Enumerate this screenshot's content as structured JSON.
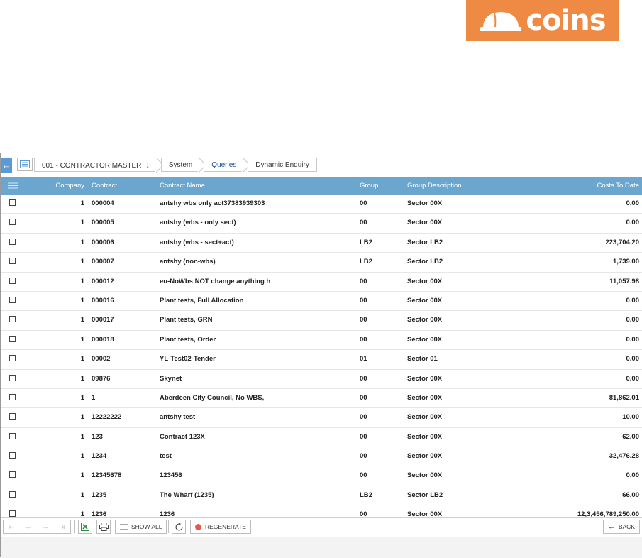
{
  "brand": {
    "name": "coins",
    "color": "#ef8a45"
  },
  "breadcrumb": [
    {
      "label": "001 - CONTRACTOR MASTER",
      "arrow": "↓"
    },
    {
      "label": "System"
    },
    {
      "label": "Queries"
    },
    {
      "label": "Dynamic Enquiry"
    }
  ],
  "table": {
    "headers": [
      "Company",
      "Contract",
      "Contract Name",
      "Group",
      "Group Description",
      "Costs To Date"
    ],
    "rows": [
      {
        "company": "1",
        "contract": "000004",
        "name": "antshy wbs only act37383939303",
        "group": "00",
        "desc": "Sector 00X",
        "cost": "0.00"
      },
      {
        "company": "1",
        "contract": "000005",
        "name": "antshy (wbs - only sect)",
        "group": "00",
        "desc": "Sector 00X",
        "cost": "0.00"
      },
      {
        "company": "1",
        "contract": "000006",
        "name": "antshy (wbs - sect+act)",
        "group": "LB2",
        "desc": "Sector LB2",
        "cost": "223,704.20"
      },
      {
        "company": "1",
        "contract": "000007",
        "name": "antshy (non-wbs)",
        "group": "LB2",
        "desc": "Sector LB2",
        "cost": "1,739.00"
      },
      {
        "company": "1",
        "contract": "000012",
        "name": "eu-NoWbs NOT change anything h",
        "group": "00",
        "desc": "Sector 00X",
        "cost": "11,057.98"
      },
      {
        "company": "1",
        "contract": "000016",
        "name": "Plant tests, Full Allocation",
        "group": "00",
        "desc": "Sector 00X",
        "cost": "0.00"
      },
      {
        "company": "1",
        "contract": "000017",
        "name": "Plant tests, GRN",
        "group": "00",
        "desc": "Sector 00X",
        "cost": "0.00"
      },
      {
        "company": "1",
        "contract": "000018",
        "name": "Plant tests, Order",
        "group": "00",
        "desc": "Sector 00X",
        "cost": "0.00"
      },
      {
        "company": "1",
        "contract": "00002",
        "name": "YL-Test02-Tender",
        "group": "01",
        "desc": "Sector 01",
        "cost": "0.00"
      },
      {
        "company": "1",
        "contract": "09876",
        "name": "Skynet",
        "group": "00",
        "desc": "Sector 00X",
        "cost": "0.00"
      },
      {
        "company": "1",
        "contract": "1",
        "name": "Aberdeen City Council, No WBS,",
        "group": "00",
        "desc": "Sector 00X",
        "cost": "81,862.01"
      },
      {
        "company": "1",
        "contract": "12222222",
        "name": "antshy test",
        "group": "00",
        "desc": "Sector 00X",
        "cost": "10.00"
      },
      {
        "company": "1",
        "contract": "123",
        "name": "Contract 123X",
        "group": "00",
        "desc": "Sector 00X",
        "cost": "62.00"
      },
      {
        "company": "1",
        "contract": "1234",
        "name": "test",
        "group": "00",
        "desc": "Sector 00X",
        "cost": "32,476.28"
      },
      {
        "company": "1",
        "contract": "12345678",
        "name": "123456",
        "group": "00",
        "desc": "Sector 00X",
        "cost": "0.00"
      },
      {
        "company": "1",
        "contract": "1235",
        "name": "The Wharf (1235)",
        "group": "LB2",
        "desc": "Sector LB2",
        "cost": "66.00"
      },
      {
        "company": "1",
        "contract": "1236",
        "name": "1236",
        "group": "00",
        "desc": "Sector 00X",
        "cost": "12,3,456,789,250.00"
      }
    ]
  },
  "toolbar": {
    "show_all_label": "SHOW ALL",
    "regenerate_label": "REGENERATE",
    "back_label": "BACK"
  },
  "colors": {
    "header_bg": "#6aa6cd",
    "nav_blue": "#5b9bd5",
    "regen_red": "#e8574e"
  }
}
